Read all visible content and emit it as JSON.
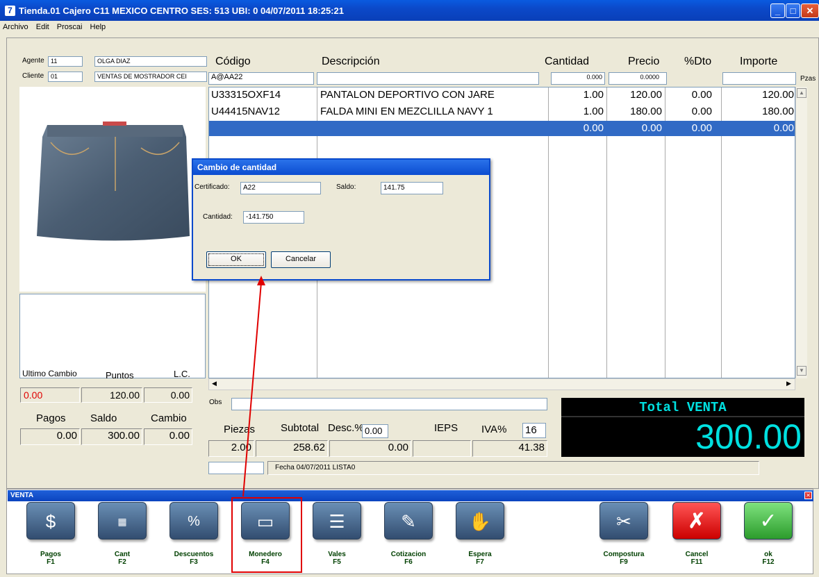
{
  "titlebar": {
    "icon": "7",
    "title": "Tienda.01  Cajero C11  MEXICO CENTRO    SES: 513  UBI: 0  04/07/2011 18:25:21"
  },
  "menu": [
    "Archivo",
    "Edit",
    "Proscai",
    "Help"
  ],
  "agente": {
    "label": "Agente",
    "code": "11",
    "name": "OLGA DIAZ"
  },
  "cliente": {
    "label": "Cliente",
    "code": "01",
    "name": "VENTAS DE MOSTRADOR CEI"
  },
  "columns": {
    "codigo": "Código",
    "descripcion": "Descripción",
    "cantidad": "Cantidad",
    "precio": "Precio",
    "dto": "%Dto",
    "importe": "Importe",
    "pzas": "Pzas"
  },
  "entry": {
    "codigo": "A@AA22",
    "cantidad": "0.000",
    "precio": "0.0000"
  },
  "rows": [
    {
      "codigo": "U33315OXF14",
      "desc": "PANTALON  DEPORTIVO CON JARE",
      "cant": "1.00",
      "precio": "120.00",
      "dto": "0.00",
      "importe": "120.00"
    },
    {
      "codigo": "U44415NAV12",
      "desc": "FALDA MINI EN MEZCLILLA NAVY 1",
      "cant": "1.00",
      "precio": "180.00",
      "dto": "0.00",
      "importe": "180.00"
    },
    {
      "codigo": "",
      "desc": "",
      "cant": "0.00",
      "precio": "0.00",
      "dto": "0.00",
      "importe": "0.00"
    }
  ],
  "left": {
    "ultimo_cambio_label": "Ultimo Cambio",
    "puntos_label": "Puntos",
    "lc_label": "L.C.",
    "ultimo_cambio": "0.00",
    "puntos": "120.00",
    "lc": "0.00",
    "pagos_label": "Pagos",
    "saldo_label": "Saldo",
    "cambio_label": "Cambio",
    "pagos": "0.00",
    "saldo": "300.00",
    "cambio": "0.00"
  },
  "obs_label": "Obs",
  "totals": {
    "piezas_label": "Piezas",
    "subtotal_label": "Subtotal",
    "desc_label": "Desc.%",
    "desc_pct": "0.00",
    "ieps_label": "IEPS",
    "iva_label": "IVA%",
    "iva_pct": "16",
    "piezas": "2.00",
    "subtotal": "258.62",
    "desc": "0.00",
    "iva": "41.38"
  },
  "status": {
    "fecha": "Fecha 04/07/2011 LISTA0"
  },
  "total": {
    "label": "Total VENTA",
    "value": "300.00"
  },
  "dialog": {
    "title": "Cambio de cantidad",
    "cert_label": "Certificado:",
    "cert": "A22",
    "saldo_label": "Saldo:",
    "saldo": "141.75",
    "cant_label": "Cantidad:",
    "cant": "-141.750",
    "ok": "OK",
    "cancel": "Cancelar"
  },
  "toolbar": {
    "title": "VENTA",
    "buttons": [
      {
        "name": "Pagos",
        "key": "F1",
        "icon": "money-icon"
      },
      {
        "name": "Cant",
        "key": "F2",
        "icon": "calculator-icon"
      },
      {
        "name": "Descuentos",
        "key": "F3",
        "icon": "percent-icon"
      },
      {
        "name": "Monedero",
        "key": "F4",
        "icon": "card-icon"
      },
      {
        "name": "Vales",
        "key": "F5",
        "icon": "voucher-icon"
      },
      {
        "name": "Cotizacion",
        "key": "F6",
        "icon": "note-icon"
      },
      {
        "name": "Espera",
        "key": "F7",
        "icon": "hand-icon"
      },
      {
        "name": "Compostura",
        "key": "F9",
        "icon": "scissors-icon"
      },
      {
        "name": "Cancel",
        "key": "F11",
        "icon": "cross-icon"
      },
      {
        "name": "ok",
        "key": "F12",
        "icon": "check-icon"
      }
    ]
  },
  "colors": {
    "title": "#0b49c9",
    "total_text": "#00e0e0",
    "annotation": "#e00000",
    "red_value": "#e00000"
  }
}
